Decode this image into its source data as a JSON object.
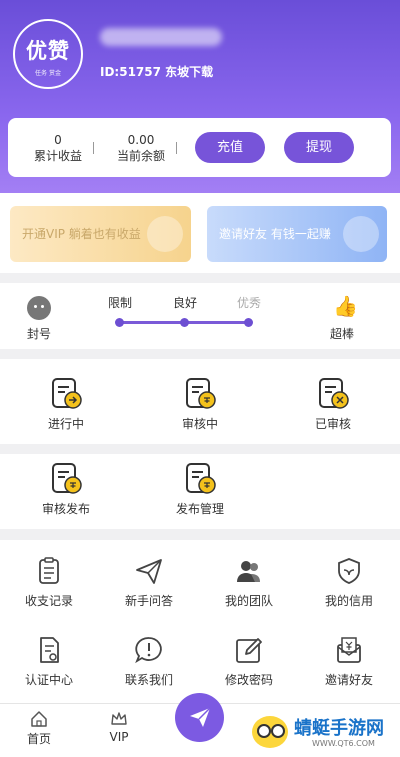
{
  "header": {
    "logo_main": "优赞",
    "logo_sub": "任务 赏金",
    "user_id_line": "ID:51757 东坡下载"
  },
  "balance": {
    "total_income_value": "0",
    "total_income_label": "累计收益",
    "current_balance_value": "0.00",
    "current_balance_label": "当前余额",
    "recharge_label": "充值",
    "withdraw_label": "提现"
  },
  "banners": {
    "vip_text": "开通VIP 躺着也有收益",
    "invite_text": "邀请好友 有钱一起赚"
  },
  "credit": {
    "ban_label": "封号",
    "levels": [
      "限制",
      "良好",
      "优秀"
    ],
    "great_label": "超棒"
  },
  "tasks_row1": [
    {
      "label": "进行中",
      "icon": "doc-arrow-icon"
    },
    {
      "label": "审核中",
      "icon": "doc-coin-icon"
    },
    {
      "label": "已审核",
      "icon": "doc-close-icon"
    }
  ],
  "tasks_row2": [
    {
      "label": "审核发布",
      "icon": "doc-coin-icon"
    },
    {
      "label": "发布管理",
      "icon": "doc-coin-icon"
    }
  ],
  "grid": [
    {
      "label": "收支记录",
      "icon": "clipboard-icon"
    },
    {
      "label": "新手问答",
      "icon": "paper-plane-icon"
    },
    {
      "label": "我的团队",
      "icon": "team-icon"
    },
    {
      "label": "我的信用",
      "icon": "shield-icon"
    },
    {
      "label": "认证中心",
      "icon": "certificate-icon"
    },
    {
      "label": "联系我们",
      "icon": "chat-alert-icon"
    },
    {
      "label": "修改密码",
      "icon": "edit-icon"
    },
    {
      "label": "邀请好友",
      "icon": "invite-envelope-icon"
    }
  ],
  "tabbar": {
    "home_label": "首页",
    "vip_label": "VIP"
  },
  "watermark": {
    "text": "蜻蜓手游网",
    "url": "WWW.QT6.COM"
  },
  "colors": {
    "accent": "#7754d9",
    "coin": "#f4c21c"
  }
}
